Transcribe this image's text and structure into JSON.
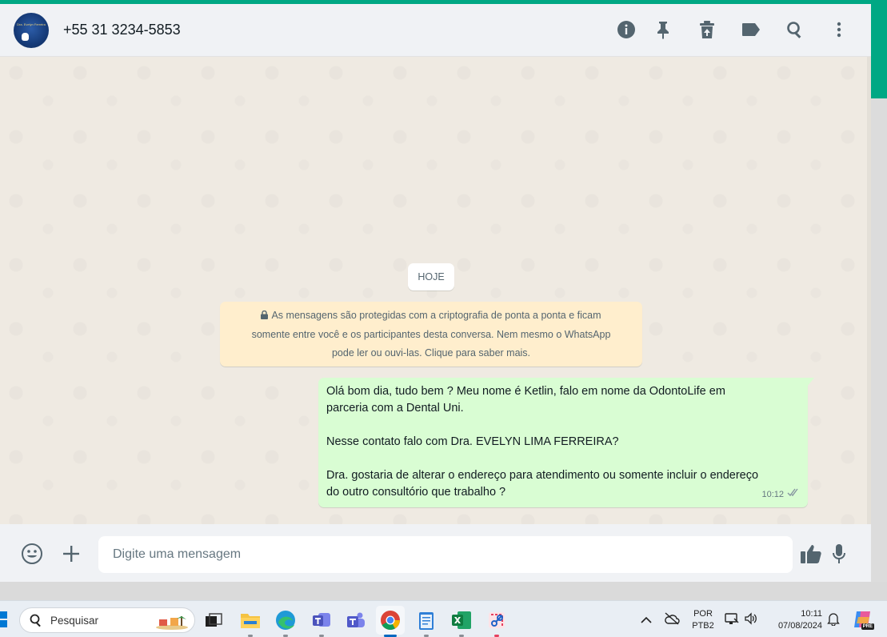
{
  "header": {
    "contact_name": "+55 31 3234-5853",
    "avatar_text": "Dra. Evelyn Ferreira"
  },
  "chat": {
    "date_chip": "HOJE",
    "encryption_notice": {
      "line1": "As mensagens são protegidas com a criptografia de ponta a ponta e ficam",
      "line2": "somente entre você e os participantes desta conversa. Nem mesmo o WhatsApp",
      "line3": "pode ler ou ouvi-las. Clique para saber mais."
    },
    "messages": [
      {
        "direction": "outgoing",
        "paragraph1_line1": "Olá bom dia, tudo bem ? Meu nome é Ketlin,  falo em nome da OdontoLife em",
        "paragraph1_line2": "parceria com a Dental Uni.",
        "paragraph2": "Nesse contato falo com Dra. EVELYN LIMA FERREIRA?",
        "paragraph3_line1": "Dra. gostaria de alterar o endereço para atendimento ou somente incluir o endereço",
        "paragraph3_line2": "do outro consultório que trabalho ?",
        "time": "10:12",
        "status": "delivered"
      }
    ]
  },
  "footer": {
    "input_placeholder": "Digite uma mensagem",
    "input_value": ""
  },
  "taskbar": {
    "search_label": "Pesquisar",
    "language": "POR",
    "keyboard": "PTB2",
    "time": "10:11",
    "date": "07/08/2024",
    "copilot_badge": "PRE"
  },
  "colors": {
    "accent": "#00a884",
    "outgoing_bubble": "#d9fdd3",
    "notice_bg": "#ffeecd",
    "header_bg": "#f0f2f5",
    "chat_bg": "#efeae2"
  }
}
